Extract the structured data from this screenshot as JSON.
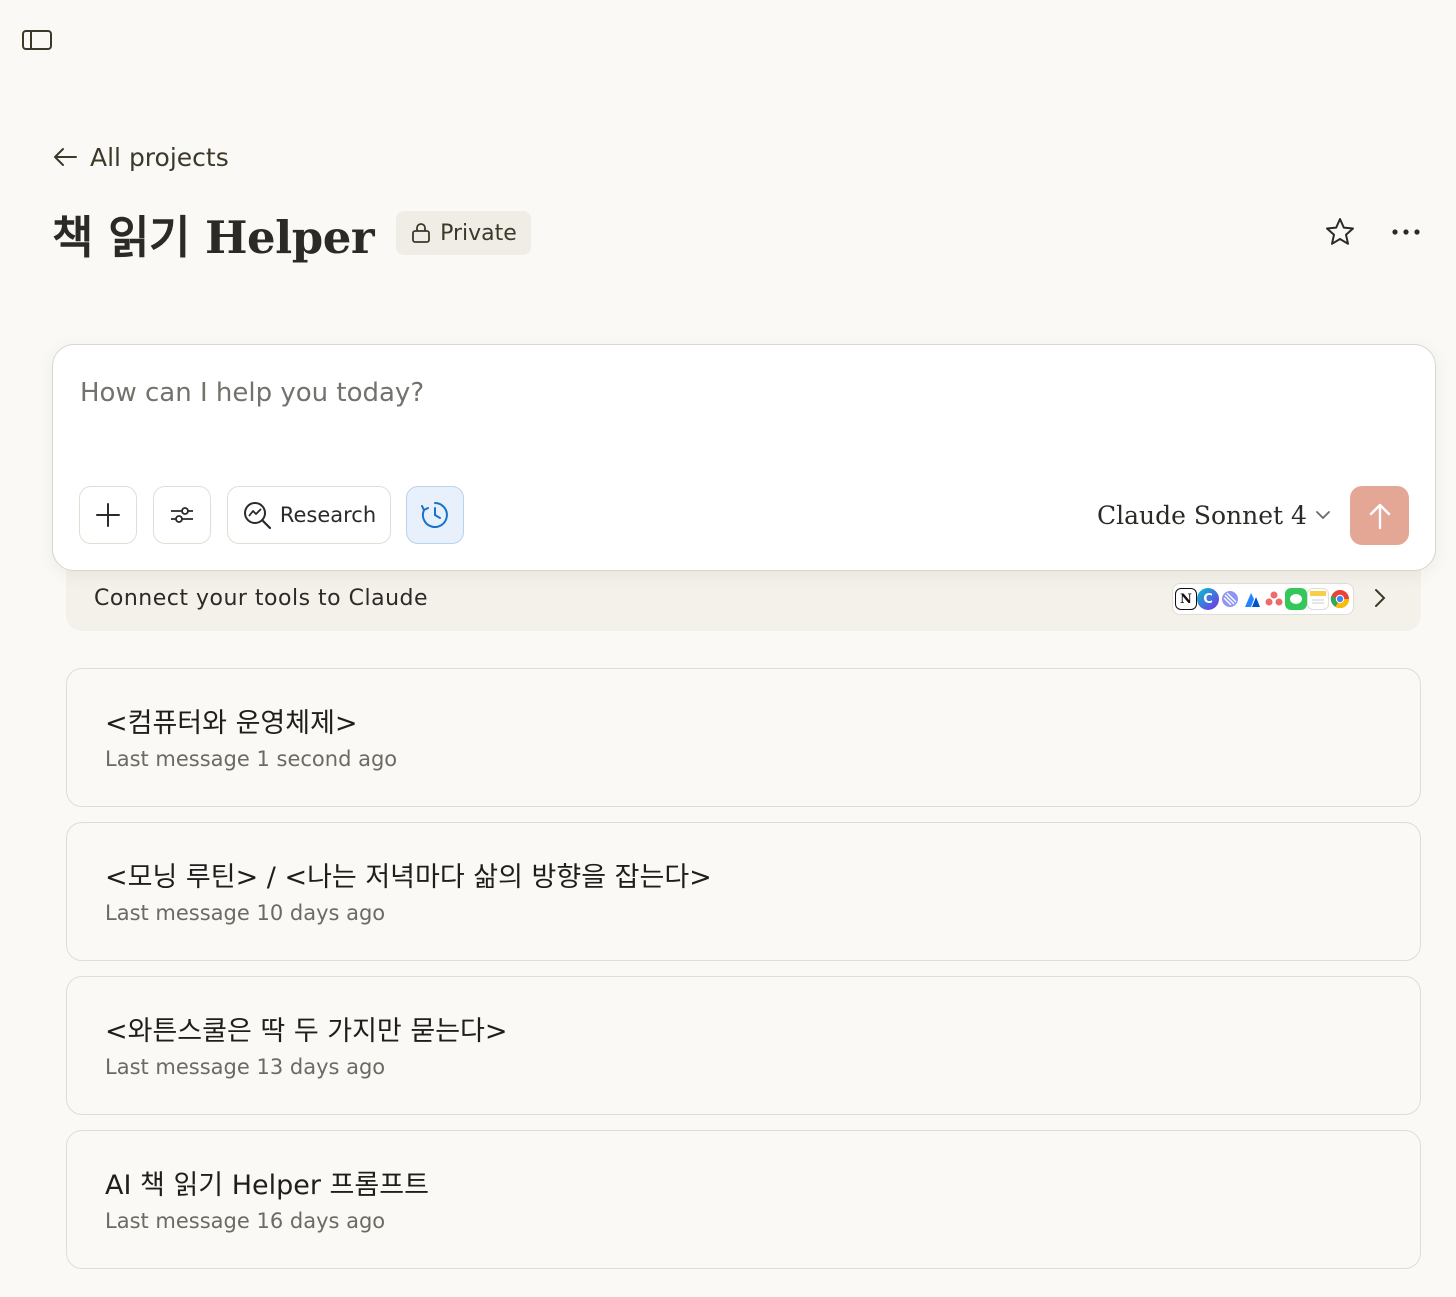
{
  "nav": {
    "back_label": "All projects"
  },
  "project": {
    "title": "책 읽기 Helper",
    "visibility": "Private"
  },
  "composer": {
    "placeholder": "How can I help you today?",
    "value": "",
    "research_label": "Research",
    "model_label": "Claude Sonnet 4"
  },
  "connect": {
    "label": "Connect your tools to Claude",
    "tools": [
      "notion-icon",
      "canva-icon",
      "linear-icon",
      "atlassian-icon",
      "asana-icon",
      "messages-icon",
      "notes-icon",
      "chrome-icon"
    ]
  },
  "chats": [
    {
      "title": "<컴퓨터와 운영체제>",
      "meta": "Last message 1 second ago"
    },
    {
      "title": "<모닝 루틴> / <나는 저녁마다 삶의 방향을 잡는다>",
      "meta": "Last message 10 days ago"
    },
    {
      "title": "<와튼스쿨은 딱 두 가지만 묻는다>",
      "meta": "Last message 13 days ago"
    },
    {
      "title": "AI 책 읽기 Helper 프롬프트",
      "meta": "Last message 16 days ago"
    }
  ],
  "colors": {
    "background": "#faf9f5",
    "send_button": "#e4a795",
    "clock_active": "#1a73c8"
  }
}
